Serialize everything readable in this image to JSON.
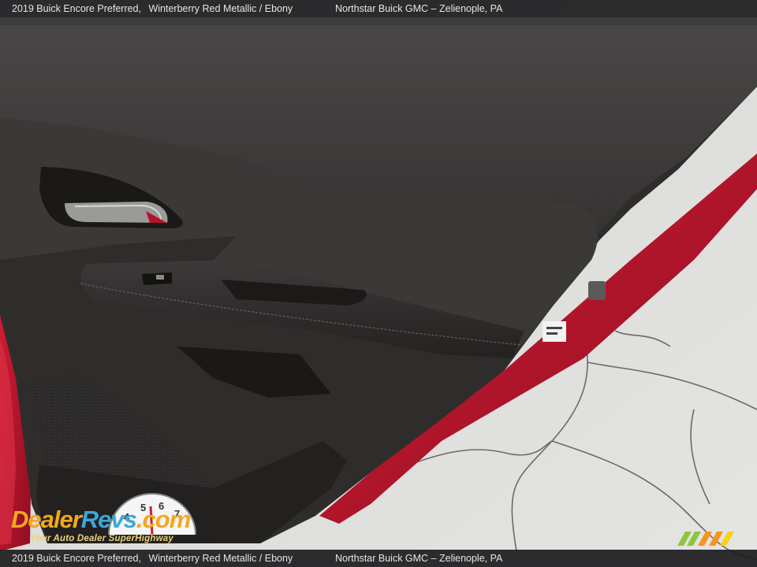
{
  "caption": {
    "vehicle": "2019 Buick Encore Preferred,",
    "color": "Winterberry Red Metallic / Ebony",
    "dealer": "Northstar Buick GMC – Zelienople, PA"
  },
  "watermark": {
    "brand": "DealerRevs.com",
    "brand_parts": [
      "Dealer",
      "Revs",
      ".com"
    ],
    "tagline": "Your Auto Dealer SuperHighway",
    "dial_digits": [
      "4",
      "5",
      "6",
      "7"
    ]
  },
  "colors": {
    "body_paint": "#b3142a",
    "door_trim": "#2c2a29",
    "pavement": "#dcdcda",
    "caption_bg": "#1c1c1e",
    "logo_orange": "#f2a81d",
    "logo_blue": "#3aa8d8",
    "wm_green": "#8cc63f"
  },
  "photo_subject": "Open rear passenger door interior panel with ebony trim, armrest, window switch and door handle"
}
